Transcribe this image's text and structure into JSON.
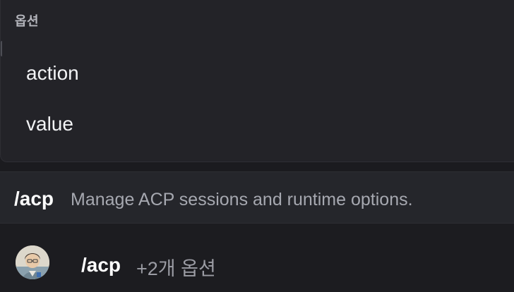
{
  "options_popup": {
    "header": "옵션",
    "items": [
      {
        "label": "action"
      },
      {
        "label": "value"
      }
    ]
  },
  "command_suggestion": {
    "name": "/acp",
    "description": "Manage ACP sessions and runtime options."
  },
  "composer": {
    "avatar_icon": "user-avatar-icon",
    "command": "/acp",
    "extra_options": "+2개 옵션"
  },
  "colors": {
    "background": "#1b1b1f",
    "panel": "#232328",
    "row_highlight": "#25262b",
    "text_primary": "#f2f3f5",
    "text_muted": "#a6a8b0"
  }
}
